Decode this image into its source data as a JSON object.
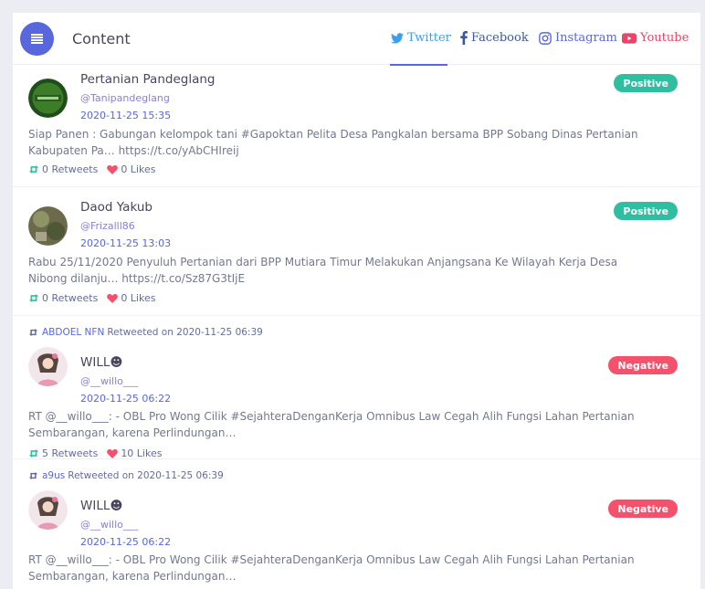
{
  "header": {
    "title": "Content",
    "tabs": [
      {
        "label": "Twitter",
        "icon": "twitter-icon",
        "color": "#3b9ff0",
        "active": true
      },
      {
        "label": "Facebook",
        "icon": "facebook-icon",
        "color": "#3b5998"
      },
      {
        "label": "Instagram",
        "icon": "instagram-icon",
        "color": "#5867dd"
      },
      {
        "label": "Youtube",
        "icon": "youtube-icon",
        "color": "#e9456a"
      }
    ]
  },
  "posts": [
    {
      "name": "Pertanian Pandeglang",
      "handle": "@Tanipandeglang",
      "time": "2020-11-25 15:35",
      "text": "Siap Panen : Gabungan kelompok tani #Gapoktan Pelita Desa Pangkalan bersama BPP Sobang Dinas Pertanian Kabupaten Pa… https://t.co/yAbCHIreij",
      "retweets": "0 Retweets",
      "likes": "0 Likes",
      "sentiment": "Positive"
    },
    {
      "name": "Daod Yakub",
      "handle": "@Frizalll86",
      "time": "2020-11-25 13:03",
      "text": "Rabu 25/11/2020 Penyuluh Pertanian dari BPP Mutiara Timur Melakukan Anjangsana Ke Wilayah Kerja Desa Nibong dilanju… https://t.co/Sz87G3tIjE",
      "retweets": "0 Retweets",
      "likes": "0 Likes",
      "sentiment": "Positive"
    },
    {
      "retweeted_by": "ABDOEL NFN",
      "retweeted_text": "Retweeted on 2020-11-25 06:39",
      "name": "WILL☻",
      "handle": "@__willo___",
      "time": "2020-11-25 06:22",
      "text": "RT @__willo___: - OBL Pro Wong Cilik #SejahteraDenganKerja Omnibus Law Cegah Alih Fungsi Lahan Pertanian Sembarangan, karena Perlindungan…",
      "retweets": "5 Retweets",
      "likes": "10 Likes",
      "sentiment": "Negative"
    },
    {
      "retweeted_by": "a9us",
      "retweeted_text": "Retweeted on 2020-11-25 06:39",
      "name": "WILL☻",
      "handle": "@__willo___",
      "time": "2020-11-25 06:22",
      "text": "RT @__willo___: - OBL Pro Wong Cilik #SejahteraDenganKerja Omnibus Law Cegah Alih Fungsi Lahan Pertanian Sembarangan, karena Perlindungan…",
      "sentiment": "Negative"
    }
  ]
}
